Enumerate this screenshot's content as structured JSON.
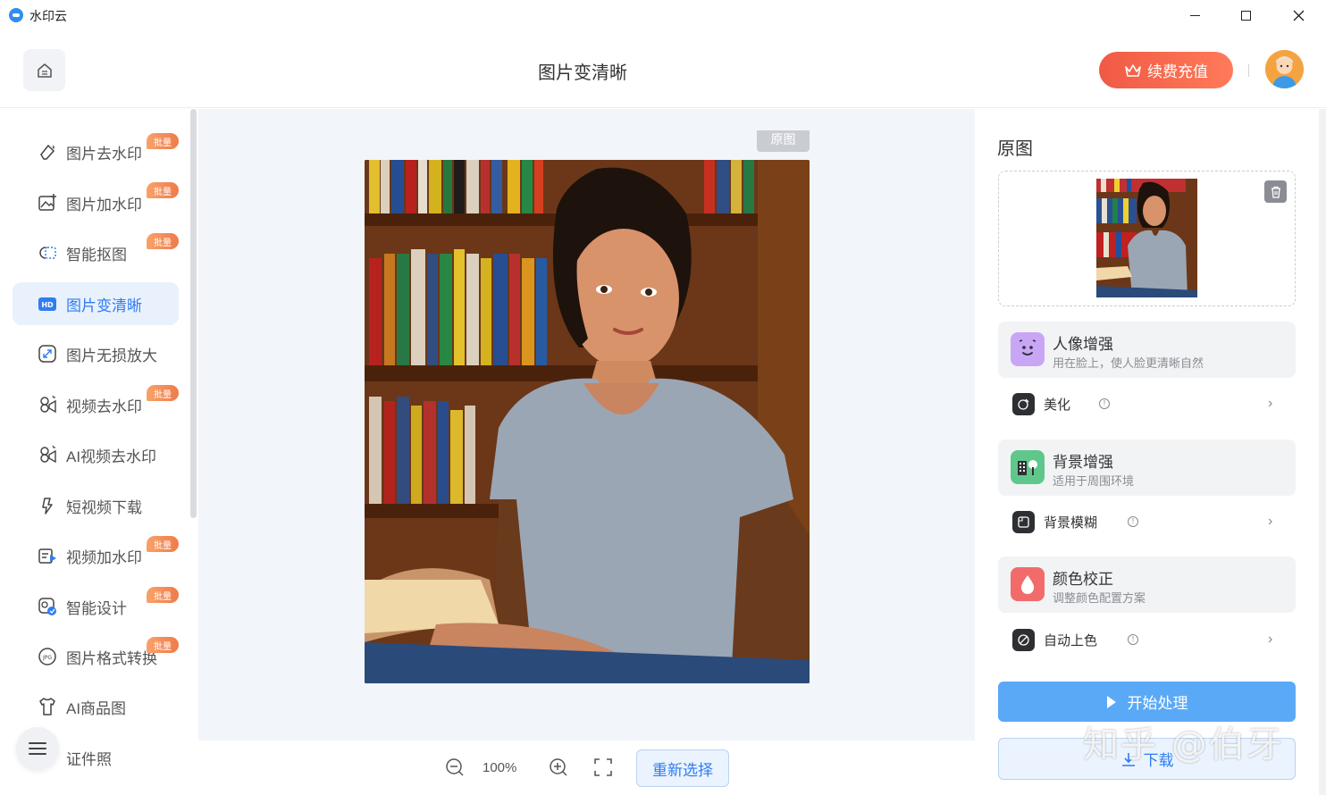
{
  "window": {
    "title": "水印云"
  },
  "header": {
    "page_title": "图片变清晰",
    "renew_label": "续费充值"
  },
  "sidebar": {
    "items": [
      {
        "label": "图片去水印",
        "icon": "eraser-icon",
        "badge": "批量",
        "active": false
      },
      {
        "label": "图片加水印",
        "icon": "image-add-icon",
        "badge": "批量",
        "active": false
      },
      {
        "label": "智能抠图",
        "icon": "cutout-icon",
        "badge": "批量",
        "active": false
      },
      {
        "label": "图片变清晰",
        "icon": "hd-icon",
        "badge": "",
        "active": true
      },
      {
        "label": "图片无损放大",
        "icon": "enlarge-icon",
        "badge": "",
        "active": false
      },
      {
        "label": "视频去水印",
        "icon": "video-eraser-icon",
        "badge": "批量",
        "active": false
      },
      {
        "label": "AI视频去水印",
        "icon": "ai-video-icon",
        "badge": "",
        "active": false
      },
      {
        "label": "短视频下载",
        "icon": "link-download-icon",
        "badge": "",
        "active": false
      },
      {
        "label": "视频加水印",
        "icon": "video-add-icon",
        "badge": "批量",
        "active": false
      },
      {
        "label": "智能设计",
        "icon": "design-icon",
        "badge": "批量",
        "active": false
      },
      {
        "label": "图片格式转换",
        "icon": "format-convert-icon",
        "badge": "批量",
        "active": false
      },
      {
        "label": "AI商品图",
        "icon": "tshirt-icon",
        "badge": "",
        "active": false
      },
      {
        "label": "证件照",
        "icon": "id-photo-icon",
        "badge": "",
        "active": false
      }
    ]
  },
  "canvas": {
    "original_tag": "原图",
    "zoom_level": "100%",
    "reselect_label": "重新选择"
  },
  "right_panel": {
    "title": "原图",
    "cards": [
      {
        "title": "人像增强",
        "subtitle": "用在脸上，使人脸更清晰自然",
        "icon": "face-icon",
        "color": "#c9a6f5",
        "option": "美化",
        "option_icon": "beauty-icon"
      },
      {
        "title": "背景增强",
        "subtitle": "适用于周围环境",
        "icon": "building-icon",
        "color": "#5fc78b",
        "option": "背景模糊",
        "option_icon": "blur-icon"
      },
      {
        "title": "颜色校正",
        "subtitle": "调整颜色配置方案",
        "icon": "drop-icon",
        "color": "#f26b6b",
        "option": "自动上色",
        "option_icon": "colorize-icon"
      }
    ],
    "start_label": "开始处理",
    "download_label": "下载"
  },
  "watermark_text": "知乎 @伯牙",
  "colors": {
    "accent": "#2f7df0",
    "active_bg": "#e9f1fd",
    "renew": "#f05a45",
    "badge": "#ef7b4a",
    "start_button": "#5aa9f7"
  }
}
